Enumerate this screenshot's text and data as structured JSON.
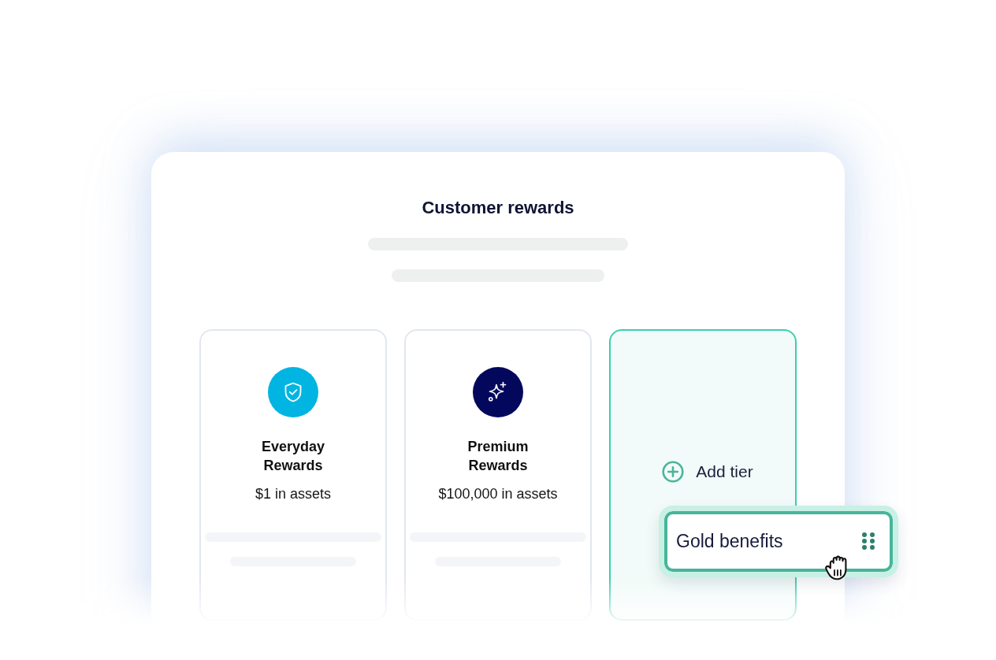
{
  "panel": {
    "title": "Customer rewards"
  },
  "tiers": [
    {
      "kind": "tier",
      "name": "Everyday Rewards",
      "requirement": "$1 in assets",
      "color": "#00b5e2"
    },
    {
      "kind": "tier",
      "name": "Premium Rewards",
      "requirement": "$100,000 in assets",
      "color": "#03085c"
    },
    {
      "kind": "add",
      "label": "Add tier"
    }
  ],
  "dragged_item": {
    "label": "Gold benefits"
  }
}
